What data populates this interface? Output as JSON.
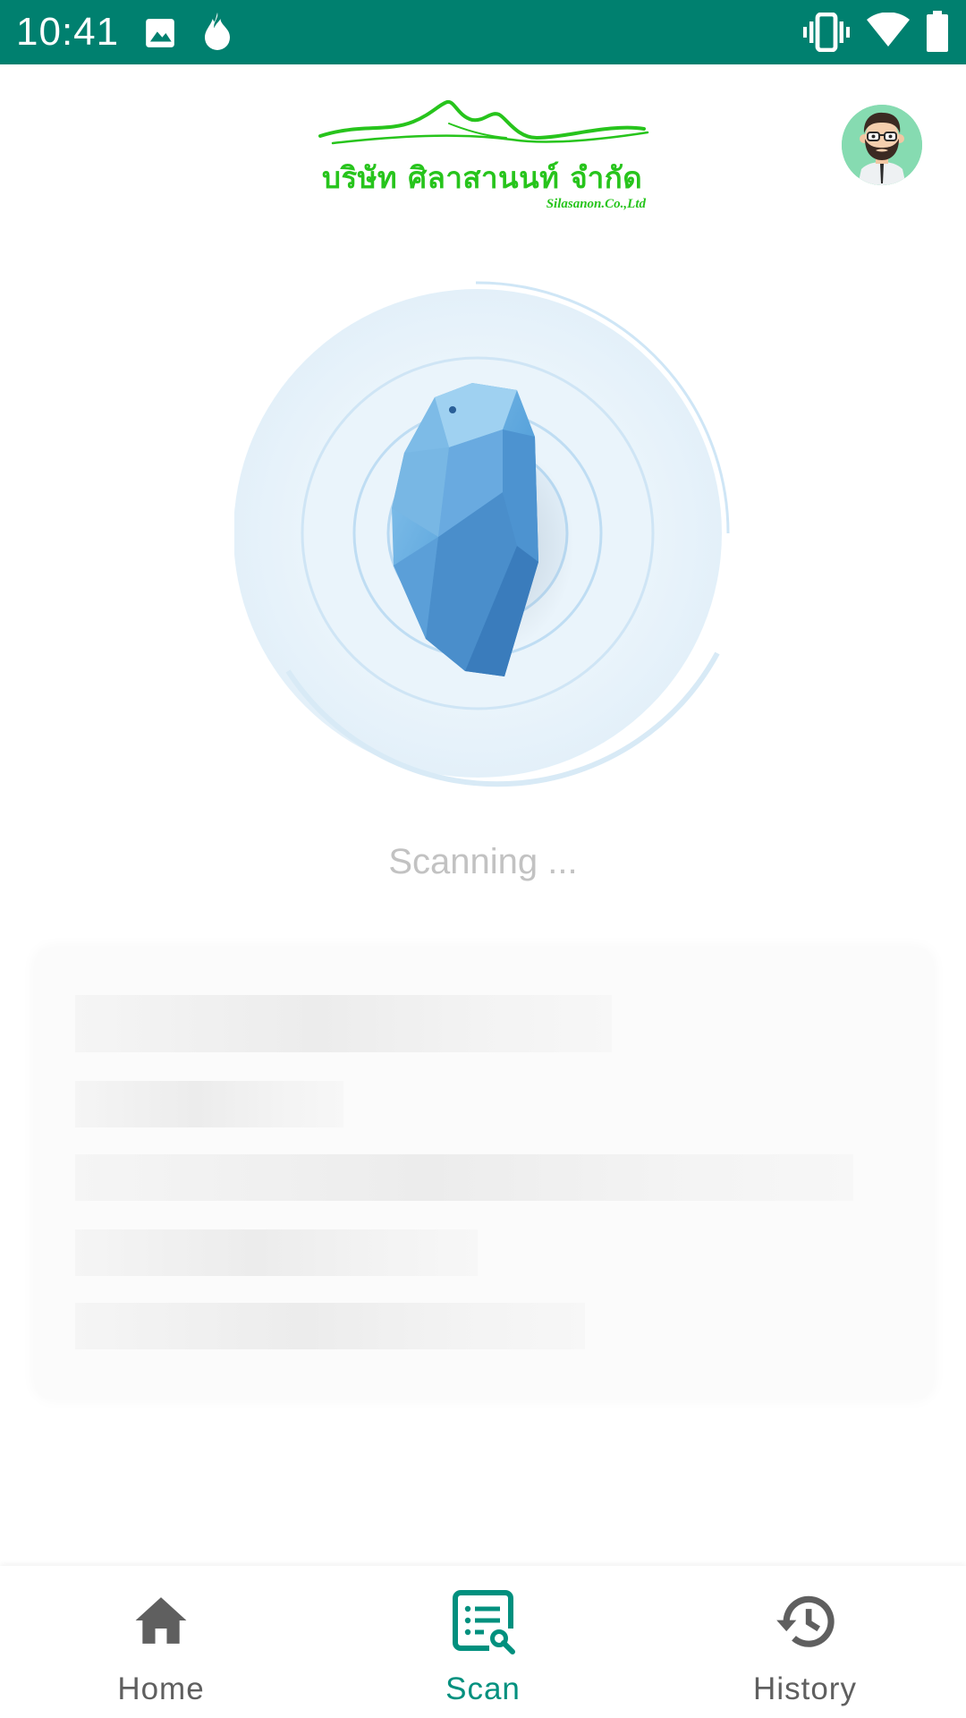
{
  "status_bar": {
    "time": "10:41",
    "left_icons": [
      "image-icon",
      "flame-icon"
    ],
    "right_icons": [
      "vibrate-icon",
      "wifi-icon",
      "battery-icon"
    ],
    "background_color": "#00806F"
  },
  "header": {
    "logo_text_thai": "บริษัท ศิลาสานนท์ จำกัด",
    "logo_text_en": "Silasanon.Co.,Ltd",
    "logo_color": "#27C41C",
    "avatar_icon": "bearded-man-avatar"
  },
  "scanner": {
    "beacon_icon": "beacon-icon",
    "status_text": "Scanning ..."
  },
  "bottom_nav": {
    "items": [
      {
        "label": "Home",
        "icon": "home-icon",
        "active": false
      },
      {
        "label": "Scan",
        "icon": "scan-list-icon",
        "active": true
      },
      {
        "label": "History",
        "icon": "history-icon",
        "active": false
      }
    ],
    "active_color": "#00907E",
    "inactive_color": "#5f5f5f"
  }
}
